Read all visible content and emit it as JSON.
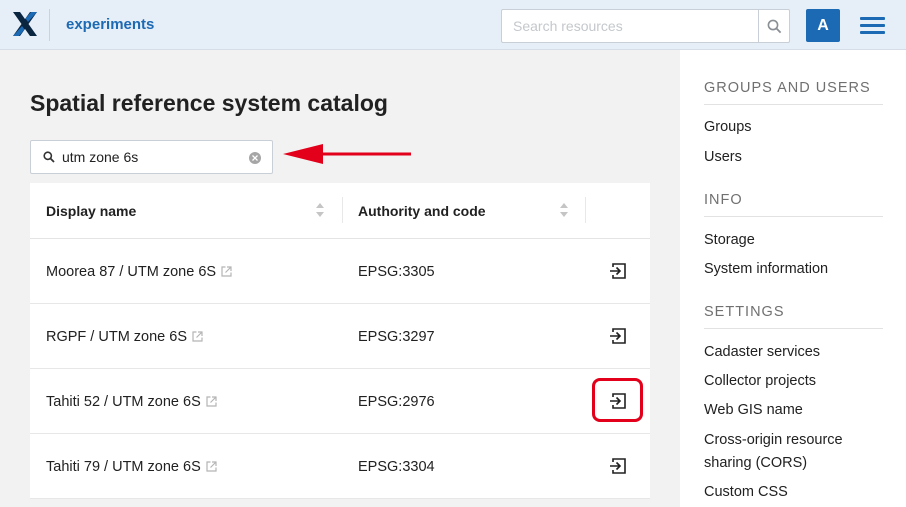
{
  "header": {
    "app_name": "experiments",
    "search_placeholder": "Search resources",
    "avatar_letter": "A",
    "brand_color": "#1c69b4"
  },
  "main": {
    "title": "Spatial reference system catalog",
    "filter_value": "utm zone 6s",
    "columns": [
      "Display name",
      "Authority and code"
    ],
    "rows": [
      {
        "name": "Moorea 87 / UTM zone 6S",
        "code": "EPSG:3305"
      },
      {
        "name": "RGPF / UTM zone 6S",
        "code": "EPSG:3297"
      },
      {
        "name": "Tahiti 52 / UTM zone 6S",
        "code": "EPSG:2976"
      },
      {
        "name": "Tahiti 79 / UTM zone 6S",
        "code": "EPSG:3304"
      }
    ],
    "highlight_color": "#e3001b"
  },
  "sidebar": {
    "groups_title": "GROUPS AND USERS",
    "groups_items": [
      "Groups",
      "Users"
    ],
    "info_title": "INFO",
    "info_items": [
      "Storage",
      "System information"
    ],
    "settings_title": "SETTINGS",
    "settings_items": [
      "Cadaster services",
      "Collector projects",
      "Web GIS name",
      "Cross-origin resource sharing (CORS)",
      "Custom CSS"
    ]
  }
}
